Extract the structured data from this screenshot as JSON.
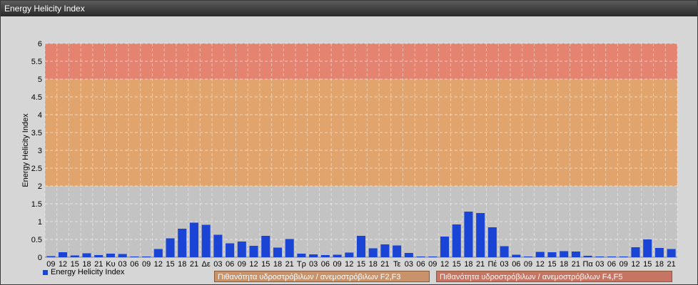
{
  "window": {
    "title": "Energy Helicity Index"
  },
  "legend": {
    "series_label": "Energy Helicity Index"
  },
  "zones": {
    "f2f3": "Πιθανότητα υδροστρόβιλων / ανεμοστρόβιλων F2,F3",
    "f4f5": "Πιθανότητα υδροστρόβιλων / ανεμοστρόβιλων F4,F5"
  },
  "colors": {
    "bar": "#1a44d6",
    "band_low": "#c3c3c3",
    "band_mid": "#e0a46c",
    "band_high": "#e38370"
  },
  "chart_data": {
    "type": "bar",
    "ylabel": "Energy Helicity Index",
    "ylim": [
      0,
      6
    ],
    "yticks": [
      "0",
      "0.5",
      "1",
      "1.5",
      "2",
      "2.5",
      "3",
      "3.5",
      "4",
      "4.5",
      "5",
      "5.5",
      "6"
    ],
    "bands": [
      {
        "from": 0,
        "to": 2,
        "color": "#c3c3c3"
      },
      {
        "from": 2,
        "to": 5,
        "color": "#e0a46c"
      },
      {
        "from": 5,
        "to": 6,
        "color": "#e38370"
      }
    ],
    "grid": true,
    "categories": [
      "09",
      "12",
      "15",
      "18",
      "21",
      "Κυ",
      "03",
      "06",
      "09",
      "12",
      "15",
      "18",
      "21",
      "Δε",
      "03",
      "06",
      "09",
      "12",
      "15",
      "18",
      "21",
      "Τρ",
      "03",
      "06",
      "09",
      "12",
      "15",
      "18",
      "21",
      "Τε",
      "03",
      "06",
      "09",
      "12",
      "15",
      "18",
      "21",
      "Πέ",
      "03",
      "06",
      "09",
      "12",
      "15",
      "18",
      "21",
      "Πα",
      "03",
      "06",
      "09",
      "12",
      "15",
      "18",
      "21"
    ],
    "values": [
      0.03,
      0.14,
      0.05,
      0.11,
      0.06,
      0.1,
      0.09,
      0.02,
      0.02,
      0.23,
      0.53,
      0.8,
      0.97,
      0.91,
      0.63,
      0.39,
      0.44,
      0.32,
      0.6,
      0.27,
      0.51,
      0.1,
      0.08,
      0.06,
      0.07,
      0.13,
      0.6,
      0.25,
      0.36,
      0.33,
      0.12,
      0.02,
      0.02,
      0.58,
      0.92,
      1.28,
      1.24,
      0.84,
      0.31,
      0.07,
      0.02,
      0.15,
      0.14,
      0.17,
      0.16,
      0.04,
      0.02,
      0.02,
      0.02,
      0.28,
      0.5,
      0.26,
      0.23
    ]
  }
}
